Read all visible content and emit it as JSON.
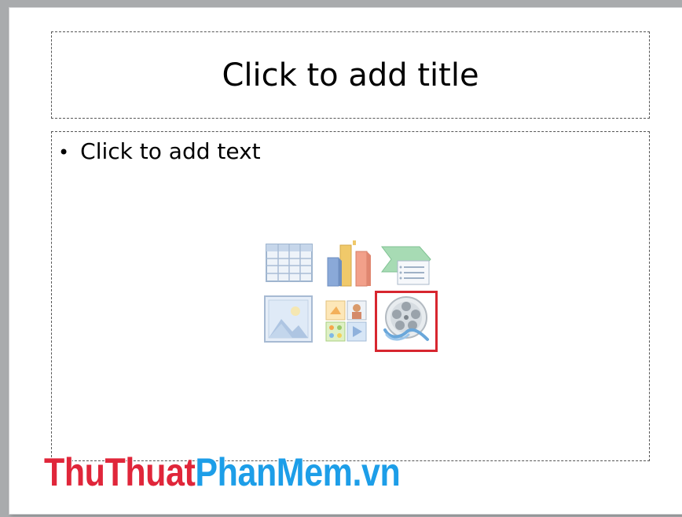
{
  "slide": {
    "title_placeholder": "Click to add title",
    "content_placeholder": {
      "bullet": "•",
      "text": "Click to add text"
    },
    "insert_icons": [
      {
        "name": "insert-table-icon"
      },
      {
        "name": "insert-chart-icon"
      },
      {
        "name": "insert-smartart-icon"
      },
      {
        "name": "insert-picture-icon"
      },
      {
        "name": "insert-clip-art-icon"
      },
      {
        "name": "insert-media-clip-icon",
        "highlighted": true
      }
    ],
    "highlight_color": "#d7262f"
  },
  "watermark": {
    "part1": "ThuThuat",
    "part2": "PhanMem.vn",
    "color1": "#e0263a",
    "color2": "#1d9ee8"
  }
}
